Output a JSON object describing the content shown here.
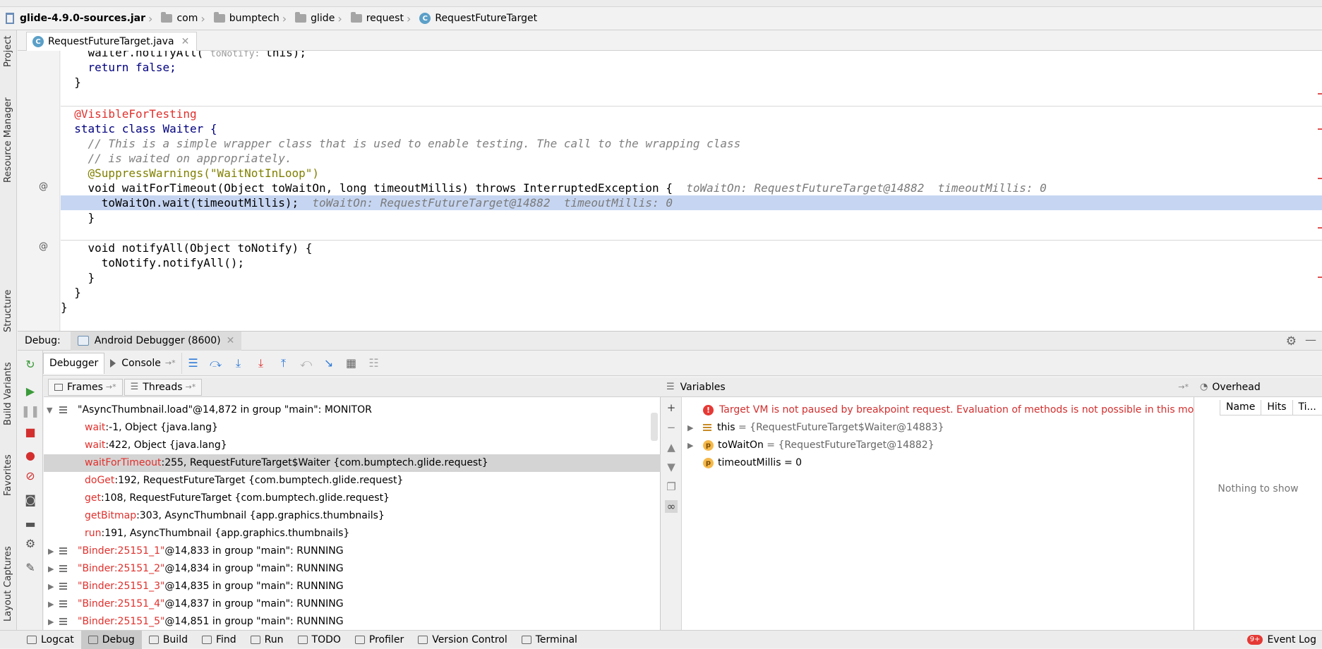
{
  "breadcrumb": {
    "jar": "glide-4.9.0-sources.jar",
    "items": [
      "com",
      "bumptech",
      "glide",
      "request"
    ],
    "class": "RequestFutureTarget"
  },
  "left_strip": [
    "Project",
    "Resource Manager",
    "Structure",
    "Build Variants",
    "Favorites",
    "Layout Captures"
  ],
  "editor": {
    "tab_label": "RequestFutureTarget.java",
    "class_icon": "C",
    "lines": [
      {
        "code": "    waiter.notifyAll( ",
        "hint": "toNotify: ",
        "rest": "this);"
      },
      {
        "code": "    return false;"
      },
      {
        "code": "  }"
      },
      {
        "code": ""
      },
      {
        "code": "  @VisibleForTesting"
      },
      {
        "code": "  static class Waiter {"
      },
      {
        "code": "    // This is a simple wrapper class that is used to enable testing. The call to the wrapping class"
      },
      {
        "code": "    // is waited on appropriately."
      },
      {
        "code": "    @SuppressWarnings(\"WaitNotInLoop\")"
      },
      {
        "code": "    void waitForTimeout(Object toWaitOn, long timeoutMillis) throws InterruptedException {",
        "inline": "  toWaitOn: RequestFutureTarget@14882  timeoutMillis: 0"
      },
      {
        "code": "      toWaitOn.wait(timeoutMillis);",
        "inline": "  toWaitOn: RequestFutureTarget@14882  timeoutMillis: 0"
      },
      {
        "code": "    }"
      },
      {
        "code": ""
      },
      {
        "code": "    void notifyAll(Object toNotify) {"
      },
      {
        "code": "      toNotify.notifyAll();"
      },
      {
        "code": "    }"
      },
      {
        "code": "  }"
      },
      {
        "code": "}"
      }
    ],
    "gutter_at": "@"
  },
  "debug": {
    "label": "Debug:",
    "session_tab": "Android Debugger (8600)",
    "tabs": [
      "Debugger",
      "Console"
    ],
    "frames_tab": "Frames",
    "threads_tab": "Threads",
    "variables_title": "Variables",
    "overhead_title": "Overhead",
    "overhead_columns": [
      "Name",
      "Hits",
      "Ti..."
    ],
    "overhead_empty": "Nothing to show"
  },
  "frames": {
    "main_thread": "\"AsyncThumbnail.load\"@14,872 in group \"main\": MONITOR",
    "stack": [
      {
        "method": "wait",
        "rest": ":-1, Object {java.lang}"
      },
      {
        "method": "wait",
        "rest": ":422, Object {java.lang}"
      },
      {
        "method": "waitForTimeout",
        "rest": ":255, RequestFutureTarget$Waiter {com.bumptech.glide.request}",
        "selected": true
      },
      {
        "method": "doGet",
        "rest": ":192, RequestFutureTarget {com.bumptech.glide.request}"
      },
      {
        "method": "get",
        "rest": ":108, RequestFutureTarget {com.bumptech.glide.request}"
      },
      {
        "method": "getBitmap",
        "rest": ":303, AsyncThumbnail {app.graphics.thumbnails}"
      },
      {
        "method": "run",
        "rest": ":191, AsyncThumbnail {app.graphics.thumbnails}"
      }
    ],
    "threads": [
      {
        "name": "\"Binder:25151_1\"",
        "rest": "@14,833 in group \"main\": RUNNING"
      },
      {
        "name": "\"Binder:25151_2\"",
        "rest": "@14,834 in group \"main\": RUNNING"
      },
      {
        "name": "\"Binder:25151_3\"",
        "rest": "@14,835 in group \"main\": RUNNING"
      },
      {
        "name": "\"Binder:25151_4\"",
        "rest": "@14,837 in group \"main\": RUNNING"
      },
      {
        "name": "\"Binder:25151_5\"",
        "rest": "@14,851 in group \"main\": RUNNING"
      }
    ]
  },
  "variables": {
    "error": "Target VM is not paused by breakpoint request. Evaluation of methods is not possible in this mode",
    "rows": [
      {
        "name": "this",
        "value": " = {RequestFutureTarget$Waiter@14883}"
      },
      {
        "name": "toWaitOn",
        "value": " = {RequestFutureTarget@14882}"
      },
      {
        "name": "timeoutMillis",
        "value": " = 0"
      }
    ],
    "param_badge": "p"
  },
  "bottom_bar": {
    "items": [
      "Logcat",
      "Debug",
      "Build",
      "Find",
      "Run",
      "TODO",
      "Profiler",
      "Version Control",
      "Terminal"
    ],
    "event_log": "Event Log",
    "event_count": "9+"
  }
}
